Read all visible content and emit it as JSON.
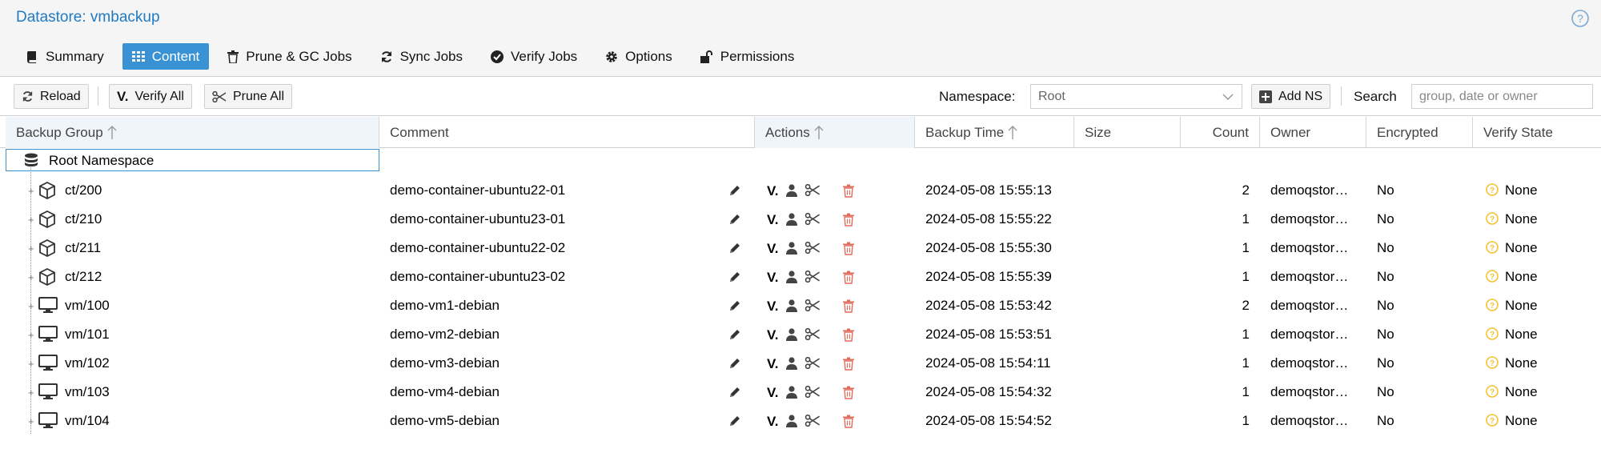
{
  "header": {
    "title": "Datastore: vmbackup",
    "help_icon": "question-circle-icon"
  },
  "tabs": [
    {
      "label": "Summary",
      "icon": "book-icon",
      "active": false
    },
    {
      "label": "Content",
      "icon": "grid-icon",
      "active": true
    },
    {
      "label": "Prune & GC Jobs",
      "icon": "trash-icon",
      "active": false
    },
    {
      "label": "Sync Jobs",
      "icon": "refresh-icon",
      "active": false
    },
    {
      "label": "Verify Jobs",
      "icon": "check-circle-icon",
      "active": false
    },
    {
      "label": "Options",
      "icon": "gear-icon",
      "active": false
    },
    {
      "label": "Permissions",
      "icon": "unlock-icon",
      "active": false
    }
  ],
  "toolbar": {
    "reload_label": "Reload",
    "verify_all_label": "Verify All",
    "prune_all_label": "Prune All",
    "namespace_label": "Namespace:",
    "namespace_value": "Root",
    "add_ns_label": "Add NS",
    "search_label": "Search",
    "search_placeholder": "group, date or owner"
  },
  "columns": {
    "backup_group": "Backup Group",
    "comment": "Comment",
    "actions": "Actions",
    "backup_time": "Backup Time",
    "size": "Size",
    "count": "Count",
    "owner": "Owner",
    "encrypted": "Encrypted",
    "verify_state": "Verify State"
  },
  "root_namespace": "Root Namespace",
  "rows": [
    {
      "group": "ct/200",
      "type": "container",
      "comment": "demo-container-ubuntu22-01",
      "time": "2024-05-08 15:55:13",
      "count": "2",
      "owner": "demoqstor…",
      "encrypted": "No",
      "verify": "None"
    },
    {
      "group": "ct/210",
      "type": "container",
      "comment": "demo-container-ubuntu23-01",
      "time": "2024-05-08 15:55:22",
      "count": "1",
      "owner": "demoqstor…",
      "encrypted": "No",
      "verify": "None"
    },
    {
      "group": "ct/211",
      "type": "container",
      "comment": "demo-container-ubuntu22-02",
      "time": "2024-05-08 15:55:30",
      "count": "1",
      "owner": "demoqstor…",
      "encrypted": "No",
      "verify": "None"
    },
    {
      "group": "ct/212",
      "type": "container",
      "comment": "demo-container-ubuntu23-02",
      "time": "2024-05-08 15:55:39",
      "count": "1",
      "owner": "demoqstor…",
      "encrypted": "No",
      "verify": "None"
    },
    {
      "group": "vm/100",
      "type": "vm",
      "comment": "demo-vm1-debian",
      "time": "2024-05-08 15:53:42",
      "count": "2",
      "owner": "demoqstor…",
      "encrypted": "No",
      "verify": "None"
    },
    {
      "group": "vm/101",
      "type": "vm",
      "comment": "demo-vm2-debian",
      "time": "2024-05-08 15:53:51",
      "count": "1",
      "owner": "demoqstor…",
      "encrypted": "No",
      "verify": "None"
    },
    {
      "group": "vm/102",
      "type": "vm",
      "comment": "demo-vm3-debian",
      "time": "2024-05-08 15:54:11",
      "count": "1",
      "owner": "demoqstor…",
      "encrypted": "No",
      "verify": "None"
    },
    {
      "group": "vm/103",
      "type": "vm",
      "comment": "demo-vm4-debian",
      "time": "2024-05-08 15:54:32",
      "count": "1",
      "owner": "demoqstor…",
      "encrypted": "No",
      "verify": "None"
    },
    {
      "group": "vm/104",
      "type": "vm",
      "comment": "demo-vm5-debian",
      "time": "2024-05-08 15:54:52",
      "count": "1",
      "owner": "demoqstor…",
      "encrypted": "No",
      "verify": "None"
    }
  ],
  "colors": {
    "accent": "#3892d4",
    "title": "#1e7ac4",
    "delete": "#e06c5c",
    "verify_unknown": "#f2c230"
  }
}
